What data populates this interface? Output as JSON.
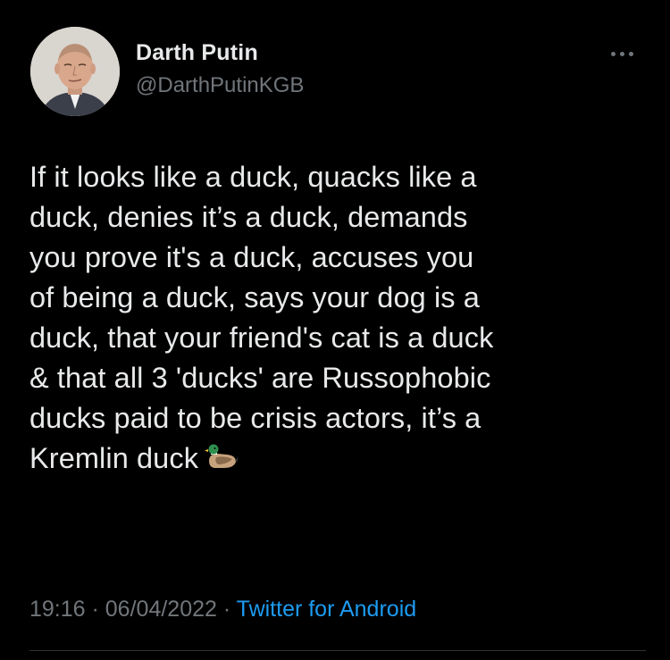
{
  "tweet": {
    "author": {
      "name": "Darth Putin",
      "handle": "@DarthPutinKGB"
    },
    "more_icon": "more-horizontal-icon",
    "text": "If it looks like a duck, quacks like a\nduck, denies it’s a duck, demands\nyou prove it's a duck, accuses you\nof being a duck, says your dog is a\nduck, that your friend's cat is a duck\n& that all 3 'ducks' are Russophobic\nducks paid to be crisis actors, it’s a\nKremlin duck",
    "emoji": "duck-emoji",
    "time": "19:16",
    "separator": " · ",
    "date": "06/04/2022",
    "source": "Twitter for Android"
  },
  "colors": {
    "background": "#000000",
    "primary_text": "#e7e9ea",
    "secondary_text": "#71767b",
    "link": "#1d9bf0"
  }
}
